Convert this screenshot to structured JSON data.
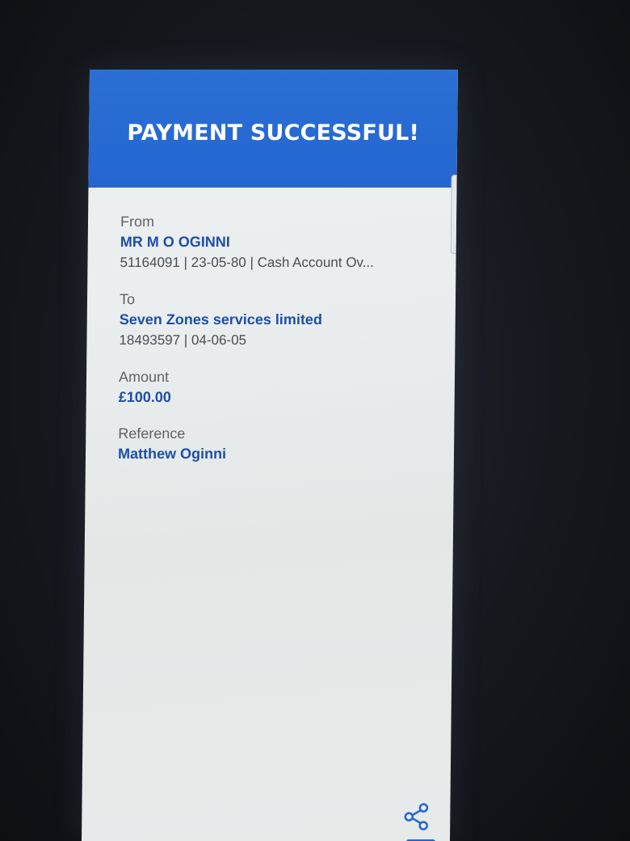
{
  "header": {
    "title": "PAYMENT SUCCESSFUL!"
  },
  "from": {
    "label": "From",
    "name": "MR M O OGINNI",
    "details": "51164091 | 23-05-80 | Cash Account Ov..."
  },
  "to": {
    "label": "To",
    "name": "Seven Zones services limited",
    "details": "18493597 | 04-06-05"
  },
  "amount": {
    "label": "Amount",
    "value": "£100.00"
  },
  "reference": {
    "label": "Reference",
    "value": "Matthew Oginni"
  },
  "actions": {
    "share_icon": "share-icon"
  },
  "colors": {
    "header_blue": "#2566d1",
    "value_blue": "#1d4fa8"
  }
}
